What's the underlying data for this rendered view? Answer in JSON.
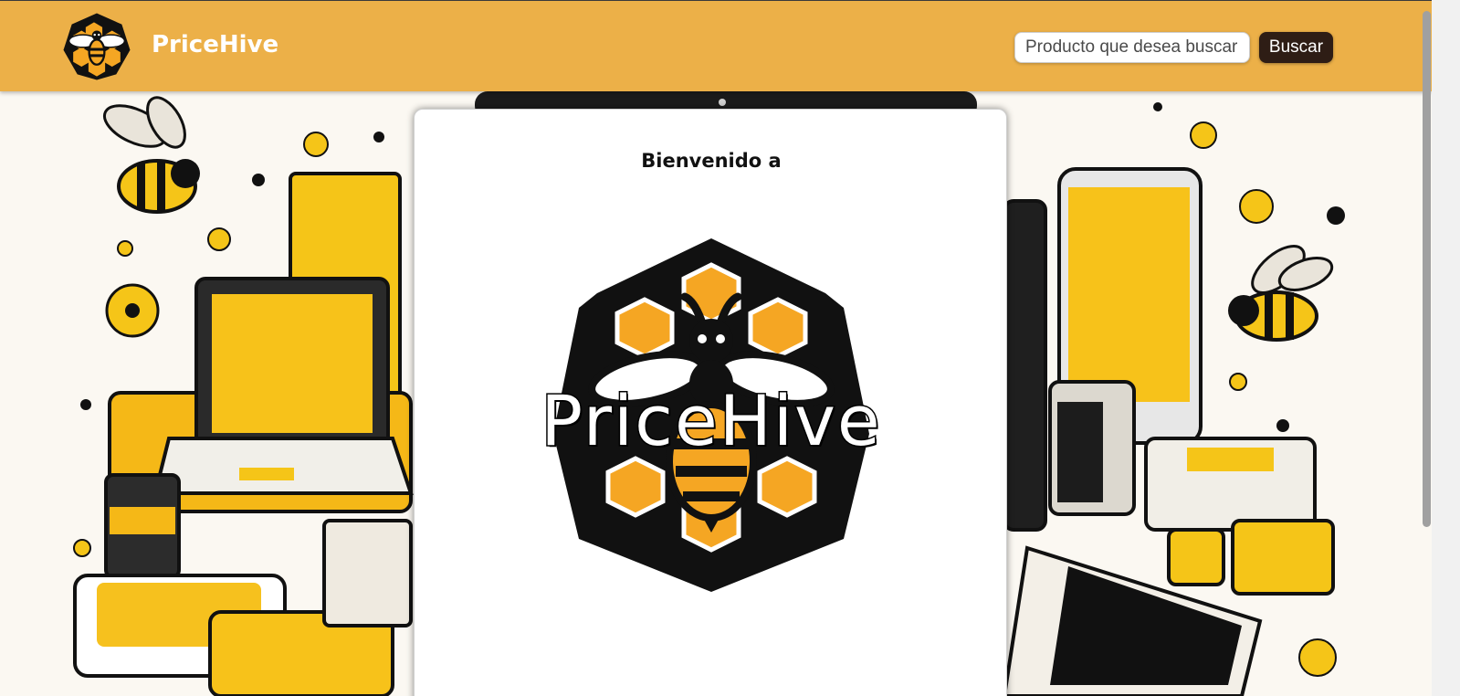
{
  "header": {
    "brand_name": "PriceHive",
    "search": {
      "placeholder": "Producto que desea buscar",
      "value": ""
    },
    "search_button_label": "Buscar"
  },
  "main": {
    "welcome_text": "Bienvenido a",
    "logo_wordmark": "PriceHive"
  },
  "colors": {
    "header_bg": "#ecb048",
    "button_bg": "#2e1d15",
    "honey": "#f5a623",
    "ink": "#000000"
  },
  "icons": [
    "bee-logo-icon",
    "bee-hive-logo"
  ]
}
